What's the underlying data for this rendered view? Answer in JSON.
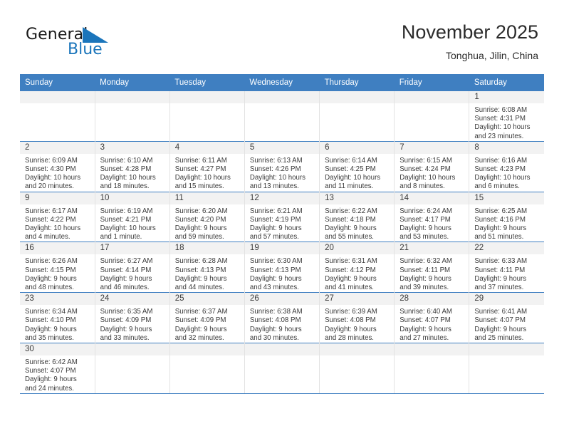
{
  "brand": {
    "line1": "General",
    "line2": "Blue",
    "flag_color": "#1b75bb"
  },
  "title": "November 2025",
  "subtitle": "Tonghua, Jilin, China",
  "theme": {
    "header_bg": "#3f7fc1",
    "daynum_bg": "#f2f2f2",
    "grid_line": "#3f7fc1",
    "text": "#3a3a3a"
  },
  "weekday_headers": [
    "Sunday",
    "Monday",
    "Tuesday",
    "Wednesday",
    "Thursday",
    "Friday",
    "Saturday"
  ],
  "weeks": [
    [
      {
        "day": "",
        "sunrise": "",
        "sunset": "",
        "daylight1": "",
        "daylight2": ""
      },
      {
        "day": "",
        "sunrise": "",
        "sunset": "",
        "daylight1": "",
        "daylight2": ""
      },
      {
        "day": "",
        "sunrise": "",
        "sunset": "",
        "daylight1": "",
        "daylight2": ""
      },
      {
        "day": "",
        "sunrise": "",
        "sunset": "",
        "daylight1": "",
        "daylight2": ""
      },
      {
        "day": "",
        "sunrise": "",
        "sunset": "",
        "daylight1": "",
        "daylight2": ""
      },
      {
        "day": "",
        "sunrise": "",
        "sunset": "",
        "daylight1": "",
        "daylight2": ""
      },
      {
        "day": "1",
        "sunrise": "Sunrise: 6:08 AM",
        "sunset": "Sunset: 4:31 PM",
        "daylight1": "Daylight: 10 hours",
        "daylight2": "and 23 minutes."
      }
    ],
    [
      {
        "day": "2",
        "sunrise": "Sunrise: 6:09 AM",
        "sunset": "Sunset: 4:30 PM",
        "daylight1": "Daylight: 10 hours",
        "daylight2": "and 20 minutes."
      },
      {
        "day": "3",
        "sunrise": "Sunrise: 6:10 AM",
        "sunset": "Sunset: 4:28 PM",
        "daylight1": "Daylight: 10 hours",
        "daylight2": "and 18 minutes."
      },
      {
        "day": "4",
        "sunrise": "Sunrise: 6:11 AM",
        "sunset": "Sunset: 4:27 PM",
        "daylight1": "Daylight: 10 hours",
        "daylight2": "and 15 minutes."
      },
      {
        "day": "5",
        "sunrise": "Sunrise: 6:13 AM",
        "sunset": "Sunset: 4:26 PM",
        "daylight1": "Daylight: 10 hours",
        "daylight2": "and 13 minutes."
      },
      {
        "day": "6",
        "sunrise": "Sunrise: 6:14 AM",
        "sunset": "Sunset: 4:25 PM",
        "daylight1": "Daylight: 10 hours",
        "daylight2": "and 11 minutes."
      },
      {
        "day": "7",
        "sunrise": "Sunrise: 6:15 AM",
        "sunset": "Sunset: 4:24 PM",
        "daylight1": "Daylight: 10 hours",
        "daylight2": "and 8 minutes."
      },
      {
        "day": "8",
        "sunrise": "Sunrise: 6:16 AM",
        "sunset": "Sunset: 4:23 PM",
        "daylight1": "Daylight: 10 hours",
        "daylight2": "and 6 minutes."
      }
    ],
    [
      {
        "day": "9",
        "sunrise": "Sunrise: 6:17 AM",
        "sunset": "Sunset: 4:22 PM",
        "daylight1": "Daylight: 10 hours",
        "daylight2": "and 4 minutes."
      },
      {
        "day": "10",
        "sunrise": "Sunrise: 6:19 AM",
        "sunset": "Sunset: 4:21 PM",
        "daylight1": "Daylight: 10 hours",
        "daylight2": "and 1 minute."
      },
      {
        "day": "11",
        "sunrise": "Sunrise: 6:20 AM",
        "sunset": "Sunset: 4:20 PM",
        "daylight1": "Daylight: 9 hours",
        "daylight2": "and 59 minutes."
      },
      {
        "day": "12",
        "sunrise": "Sunrise: 6:21 AM",
        "sunset": "Sunset: 4:19 PM",
        "daylight1": "Daylight: 9 hours",
        "daylight2": "and 57 minutes."
      },
      {
        "day": "13",
        "sunrise": "Sunrise: 6:22 AM",
        "sunset": "Sunset: 4:18 PM",
        "daylight1": "Daylight: 9 hours",
        "daylight2": "and 55 minutes."
      },
      {
        "day": "14",
        "sunrise": "Sunrise: 6:24 AM",
        "sunset": "Sunset: 4:17 PM",
        "daylight1": "Daylight: 9 hours",
        "daylight2": "and 53 minutes."
      },
      {
        "day": "15",
        "sunrise": "Sunrise: 6:25 AM",
        "sunset": "Sunset: 4:16 PM",
        "daylight1": "Daylight: 9 hours",
        "daylight2": "and 51 minutes."
      }
    ],
    [
      {
        "day": "16",
        "sunrise": "Sunrise: 6:26 AM",
        "sunset": "Sunset: 4:15 PM",
        "daylight1": "Daylight: 9 hours",
        "daylight2": "and 48 minutes."
      },
      {
        "day": "17",
        "sunrise": "Sunrise: 6:27 AM",
        "sunset": "Sunset: 4:14 PM",
        "daylight1": "Daylight: 9 hours",
        "daylight2": "and 46 minutes."
      },
      {
        "day": "18",
        "sunrise": "Sunrise: 6:28 AM",
        "sunset": "Sunset: 4:13 PM",
        "daylight1": "Daylight: 9 hours",
        "daylight2": "and 44 minutes."
      },
      {
        "day": "19",
        "sunrise": "Sunrise: 6:30 AM",
        "sunset": "Sunset: 4:13 PM",
        "daylight1": "Daylight: 9 hours",
        "daylight2": "and 43 minutes."
      },
      {
        "day": "20",
        "sunrise": "Sunrise: 6:31 AM",
        "sunset": "Sunset: 4:12 PM",
        "daylight1": "Daylight: 9 hours",
        "daylight2": "and 41 minutes."
      },
      {
        "day": "21",
        "sunrise": "Sunrise: 6:32 AM",
        "sunset": "Sunset: 4:11 PM",
        "daylight1": "Daylight: 9 hours",
        "daylight2": "and 39 minutes."
      },
      {
        "day": "22",
        "sunrise": "Sunrise: 6:33 AM",
        "sunset": "Sunset: 4:11 PM",
        "daylight1": "Daylight: 9 hours",
        "daylight2": "and 37 minutes."
      }
    ],
    [
      {
        "day": "23",
        "sunrise": "Sunrise: 6:34 AM",
        "sunset": "Sunset: 4:10 PM",
        "daylight1": "Daylight: 9 hours",
        "daylight2": "and 35 minutes."
      },
      {
        "day": "24",
        "sunrise": "Sunrise: 6:35 AM",
        "sunset": "Sunset: 4:09 PM",
        "daylight1": "Daylight: 9 hours",
        "daylight2": "and 33 minutes."
      },
      {
        "day": "25",
        "sunrise": "Sunrise: 6:37 AM",
        "sunset": "Sunset: 4:09 PM",
        "daylight1": "Daylight: 9 hours",
        "daylight2": "and 32 minutes."
      },
      {
        "day": "26",
        "sunrise": "Sunrise: 6:38 AM",
        "sunset": "Sunset: 4:08 PM",
        "daylight1": "Daylight: 9 hours",
        "daylight2": "and 30 minutes."
      },
      {
        "day": "27",
        "sunrise": "Sunrise: 6:39 AM",
        "sunset": "Sunset: 4:08 PM",
        "daylight1": "Daylight: 9 hours",
        "daylight2": "and 28 minutes."
      },
      {
        "day": "28",
        "sunrise": "Sunrise: 6:40 AM",
        "sunset": "Sunset: 4:07 PM",
        "daylight1": "Daylight: 9 hours",
        "daylight2": "and 27 minutes."
      },
      {
        "day": "29",
        "sunrise": "Sunrise: 6:41 AM",
        "sunset": "Sunset: 4:07 PM",
        "daylight1": "Daylight: 9 hours",
        "daylight2": "and 25 minutes."
      }
    ],
    [
      {
        "day": "30",
        "sunrise": "Sunrise: 6:42 AM",
        "sunset": "Sunset: 4:07 PM",
        "daylight1": "Daylight: 9 hours",
        "daylight2": "and 24 minutes."
      },
      {
        "day": "",
        "sunrise": "",
        "sunset": "",
        "daylight1": "",
        "daylight2": ""
      },
      {
        "day": "",
        "sunrise": "",
        "sunset": "",
        "daylight1": "",
        "daylight2": ""
      },
      {
        "day": "",
        "sunrise": "",
        "sunset": "",
        "daylight1": "",
        "daylight2": ""
      },
      {
        "day": "",
        "sunrise": "",
        "sunset": "",
        "daylight1": "",
        "daylight2": ""
      },
      {
        "day": "",
        "sunrise": "",
        "sunset": "",
        "daylight1": "",
        "daylight2": ""
      },
      {
        "day": "",
        "sunrise": "",
        "sunset": "",
        "daylight1": "",
        "daylight2": ""
      }
    ]
  ]
}
